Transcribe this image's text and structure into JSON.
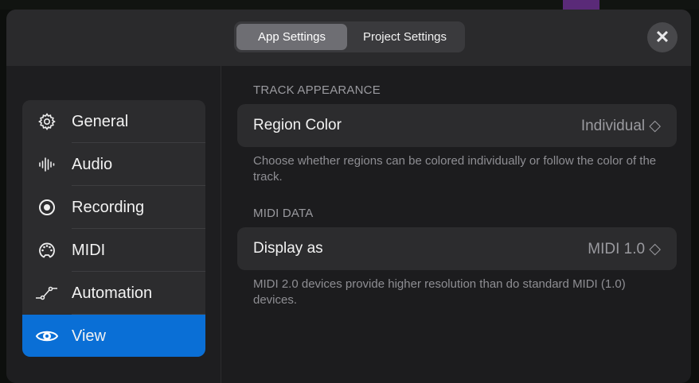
{
  "tabs": [
    {
      "label": "App Settings",
      "active": true
    },
    {
      "label": "Project Settings",
      "active": false
    }
  ],
  "close_label": "✕",
  "sidebar": {
    "items": [
      {
        "label": "General",
        "icon": "gear-icon"
      },
      {
        "label": "Audio",
        "icon": "waveform-icon"
      },
      {
        "label": "Recording",
        "icon": "record-icon"
      },
      {
        "label": "MIDI",
        "icon": "midi-port-icon"
      },
      {
        "label": "Automation",
        "icon": "automation-icon"
      },
      {
        "label": "View",
        "icon": "eye-icon",
        "selected": true
      }
    ]
  },
  "sections": [
    {
      "header": "TRACK APPEARANCE",
      "setting": "Region Color",
      "value": "Individual ◇",
      "description": "Choose whether regions can be colored individually or follow the color of the track."
    },
    {
      "header": "MIDI DATA",
      "setting": "Display as",
      "value": "MIDI 1.0 ◇",
      "description": "MIDI 2.0 devices provide higher resolution than do standard MIDI (1.0) devices."
    }
  ],
  "colors": {
    "accent": "#0a6fd6"
  }
}
